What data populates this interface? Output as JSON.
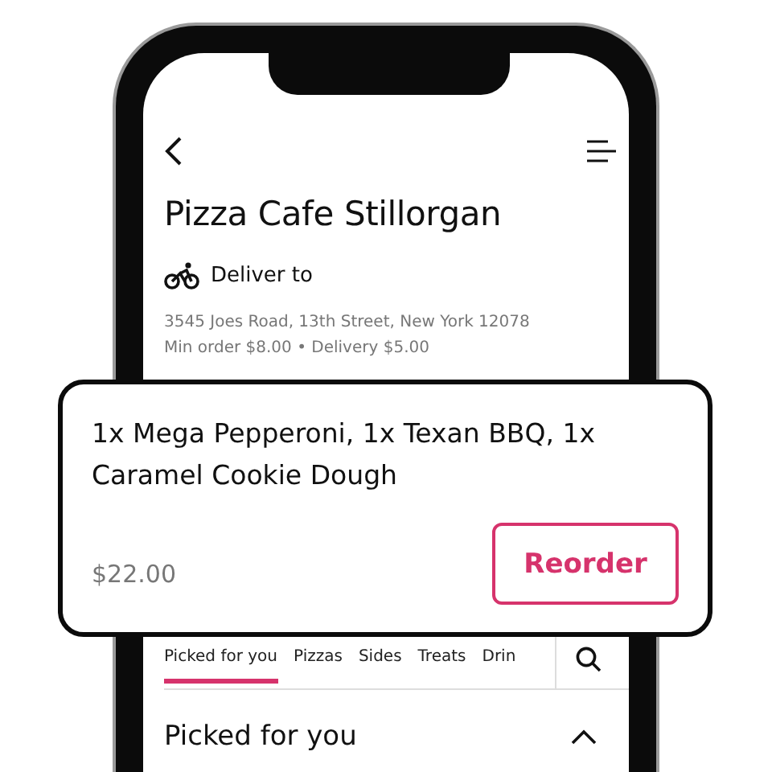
{
  "restaurant": {
    "title": "Pizza Cafe Stillorgan",
    "delivery_label": "Deliver to",
    "address": "3545 Joes Road, 13th Street, New York 12078",
    "details": "Min order $8.00 • Delivery $5.00"
  },
  "tabs": [
    {
      "label": "Picked for you",
      "selected": true
    },
    {
      "label": "Pizzas",
      "selected": false
    },
    {
      "label": "Sides",
      "selected": false
    },
    {
      "label": "Treats",
      "selected": false
    },
    {
      "label": "Drin",
      "selected": false
    }
  ],
  "section": {
    "title": "Picked for you",
    "expanded": true
  },
  "order_card": {
    "items": "1x Mega Pepperoni, 1x Texan BBQ, 1x Caramel Cookie Dough",
    "price": "$22.00",
    "button": "Reorder"
  }
}
